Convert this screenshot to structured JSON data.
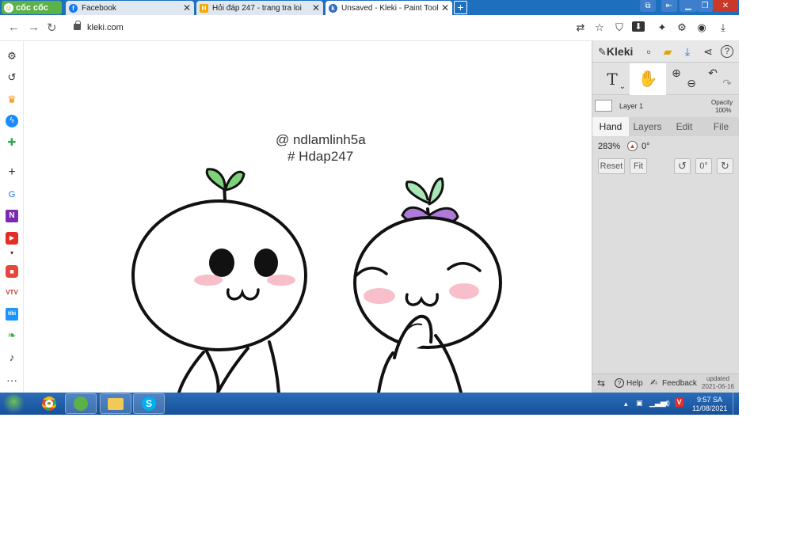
{
  "browser": {
    "brand_label": "cốc cốc",
    "tabs": [
      {
        "label": "Facebook",
        "favicon": "facebook-icon",
        "active": false
      },
      {
        "label": "Hỏi đáp 247 - trang tra loi",
        "favicon": "hoidap-icon",
        "active": false
      },
      {
        "label": "Unsaved - Kleki - Paint Tool",
        "favicon": "kleki-icon",
        "active": true
      }
    ],
    "new_tab_label": "+",
    "url": "kleki.com"
  },
  "canvas": {
    "watermark_line1": "@ ndlamlinh5a",
    "watermark_line2": "# Hdap247"
  },
  "kleki": {
    "logo_label": "Kleki",
    "layer_name": "Layer 1",
    "opacity_label": "Opacity",
    "opacity_value": "100%",
    "tabs": [
      "Hand",
      "Layers",
      "Edit",
      "File"
    ],
    "active_tab": "Hand",
    "zoom": "283%",
    "rotation": "0°",
    "reset_label": "Reset",
    "fit_label": "Fit",
    "rotate_value": "0°",
    "help_label": "Help",
    "feedback_label": "Feedback",
    "updated_label": "updated",
    "updated_date": "2021-06-16"
  },
  "taskbar": {
    "time": "9:57 SA",
    "date": "11/08/2021"
  },
  "colors": {
    "tabbar": "#1f6fbf",
    "brand_green": "#5bb247",
    "sprout_green": "#7ed37a",
    "bow_purple": "#b07ad8",
    "blush_pink": "#f7b3bf"
  }
}
